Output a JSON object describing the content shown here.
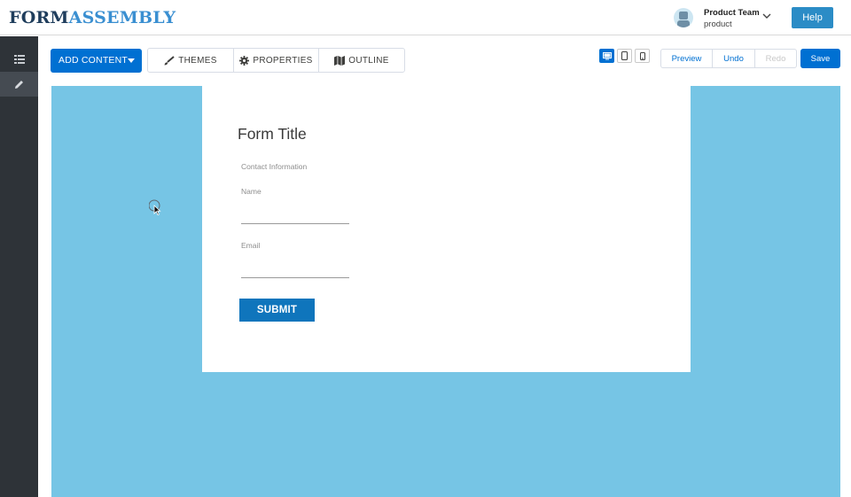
{
  "header": {
    "logo_part1": "FORM",
    "logo_part2": "ASSEMBLY",
    "user_name": "Product Team",
    "user_sub": "product",
    "help_label": "Help"
  },
  "sidebar": {
    "items": [
      {
        "icon": "list-icon"
      },
      {
        "icon": "pencil-icon",
        "active": true
      }
    ]
  },
  "toolbar": {
    "add_content_label": "ADD CONTENT",
    "tabs": [
      {
        "label": "THEMES",
        "icon": "brush-icon"
      },
      {
        "label": "PROPERTIES",
        "icon": "gear-icon"
      },
      {
        "label": "OUTLINE",
        "icon": "map-icon"
      }
    ],
    "devices": [
      {
        "icon": "desktop-icon",
        "active": true
      },
      {
        "icon": "tablet-icon",
        "active": false
      },
      {
        "icon": "phone-icon",
        "active": false
      }
    ],
    "actions": [
      {
        "label": "Preview",
        "disabled": false
      },
      {
        "label": "Undo",
        "disabled": false
      },
      {
        "label": "Redo",
        "disabled": true
      }
    ],
    "save_label": "Save"
  },
  "form": {
    "title": "Form Title",
    "section": "Contact Information",
    "fields": [
      {
        "label": "Name",
        "value": ""
      },
      {
        "label": "Email",
        "value": ""
      }
    ],
    "submit_label": "SUBMIT"
  },
  "colors": {
    "accent": "#0070d2",
    "canvas_bg": "#76c5e5",
    "sidebar_bg": "#2e3338",
    "submit_bg": "#0f75bc"
  }
}
